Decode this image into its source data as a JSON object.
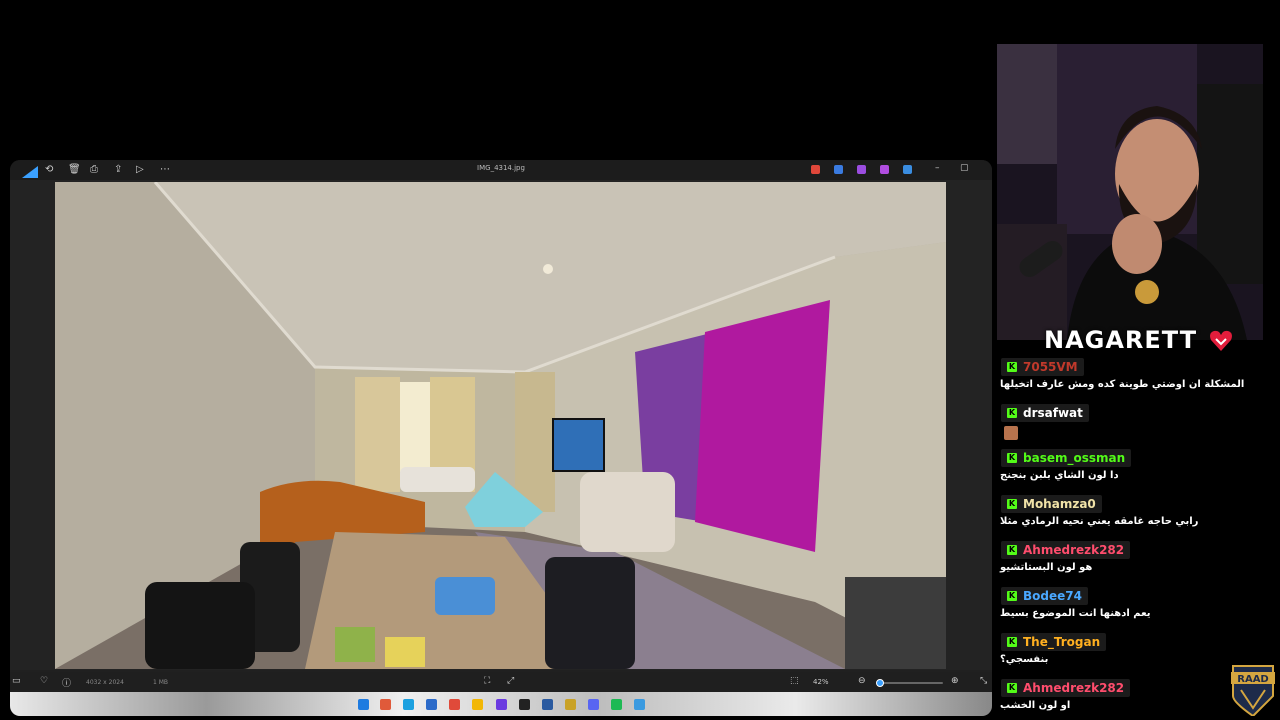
{
  "viewer": {
    "filename": "IMG_4314.jpg",
    "dimensions": "4032 x 2024",
    "filesize": "1 MB",
    "zoom": "42%",
    "zoom_fraction": 0.03
  },
  "stream": {
    "streamer_name": "NAGARETT"
  },
  "chat": {
    "messages": [
      {
        "user": "7055VM",
        "color": "#c0392b",
        "text": "المشكلة ان اوضتي طوينة كده ومش عارف اتخيلها"
      },
      {
        "user": "drsafwat",
        "color": "#ffffff",
        "text": ""
      },
      {
        "user": "basem_ossman",
        "color": "#53fc18",
        "text": "دا لون الشاي بلبن بنجنج"
      },
      {
        "user": "Mohamza0",
        "color": "#f1e3a8",
        "text": "رابي حاجه غامقه يعني نحيه الرمادي مثلا"
      },
      {
        "user": "Ahmedrezk282",
        "color": "#ff4d6d",
        "text": "هو لون البستاتشيو"
      },
      {
        "user": "Bodee74",
        "color": "#4aa8ff",
        "text": "يعم ادهنها انت الموضوع بسيط"
      },
      {
        "user": "The_Trogan",
        "color": "#ffb020",
        "text": "بنفسجي؟"
      },
      {
        "user": "Ahmedrezk282",
        "color": "#ff4d6d",
        "text": "او لون الخشب"
      }
    ]
  },
  "overlay": {
    "logo_text": "RAAD"
  }
}
